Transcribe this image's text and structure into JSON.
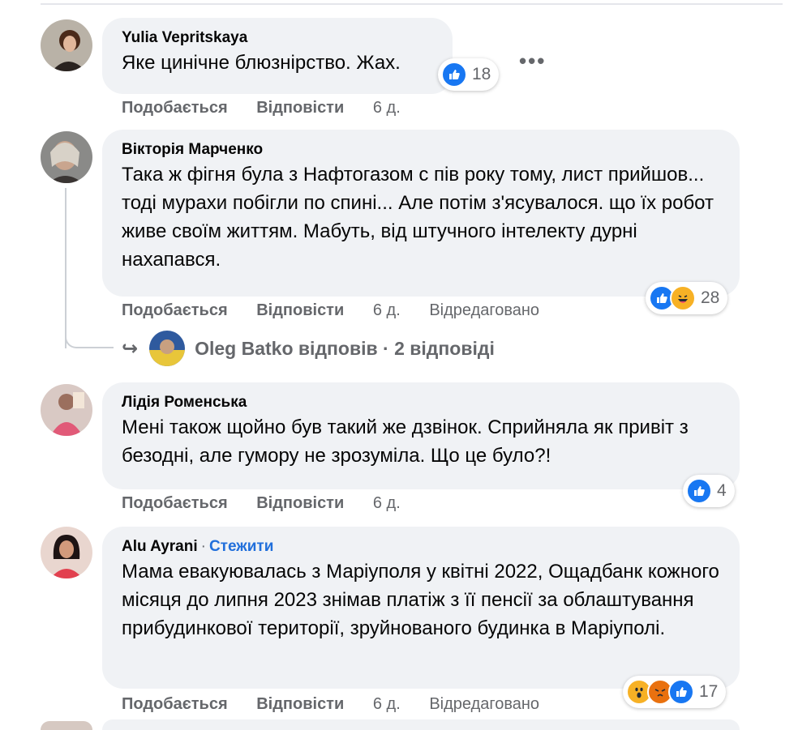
{
  "comments": [
    {
      "author": "Yulia Vepritskaya",
      "text": "Яке цинічне блюзнірство. Жах.",
      "actions": {
        "like": "Подобається",
        "reply": "Відповісти",
        "time": "6 д."
      },
      "reactions": {
        "count": "18",
        "icons": [
          "like-icon"
        ]
      },
      "more": "•••"
    },
    {
      "author": "Вікторія Марченко",
      "text": "Така ж фігня була з Нафтогазом с пів року тому, лист прийшов... тоді мурахи побігли по спині... Але потім з'ясувалося. що їх робот живе своїм життям. Мабуть, від штучного інтелекту дурні нахапався.",
      "actions": {
        "like": "Подобається",
        "reply": "Відповісти",
        "time": "6 д.",
        "edited": "Відредаговано"
      },
      "reactions": {
        "count": "28",
        "icons": [
          "like-icon",
          "haha-icon"
        ]
      },
      "replies": {
        "arrow": "↪",
        "text": "Oleg Batko відповів · 2 відповіді"
      }
    },
    {
      "author": "Лідія Роменська",
      "text": "Мені також щойно був такий же дзвінок. Сприйняла як привіт з безодні, але гумору не зрозуміла. Що це було?!",
      "actions": {
        "like": "Подобається",
        "reply": "Відповісти",
        "time": "6 д."
      },
      "reactions": {
        "count": "4",
        "icons": [
          "like-icon"
        ]
      }
    },
    {
      "author": "Alu Ayrani",
      "follow": "Стежити",
      "separator": "·",
      "text": "Мама евакуювалась з Маріуполя у квітні 2022, Ощадбанк кожного місяця до липня 2023 знімав платіж з її пенсії за облаштування прибудинкової території, зруйнованого будинка в Маріуполі.",
      "actions": {
        "like": "Подобається",
        "reply": "Відповісти",
        "time": "6 д.",
        "edited": "Відредаговано"
      },
      "reactions": {
        "count": "17",
        "icons": [
          "wow-icon",
          "angry-icon",
          "like-icon"
        ]
      }
    }
  ],
  "colors": {
    "bubble": "#f0f2f5",
    "secondary_text": "#65676b",
    "like_blue": "#1877f2",
    "follow_blue": "#216fdb",
    "haha_yellow": "#f7b125",
    "angry_orange": "#e9710f"
  }
}
